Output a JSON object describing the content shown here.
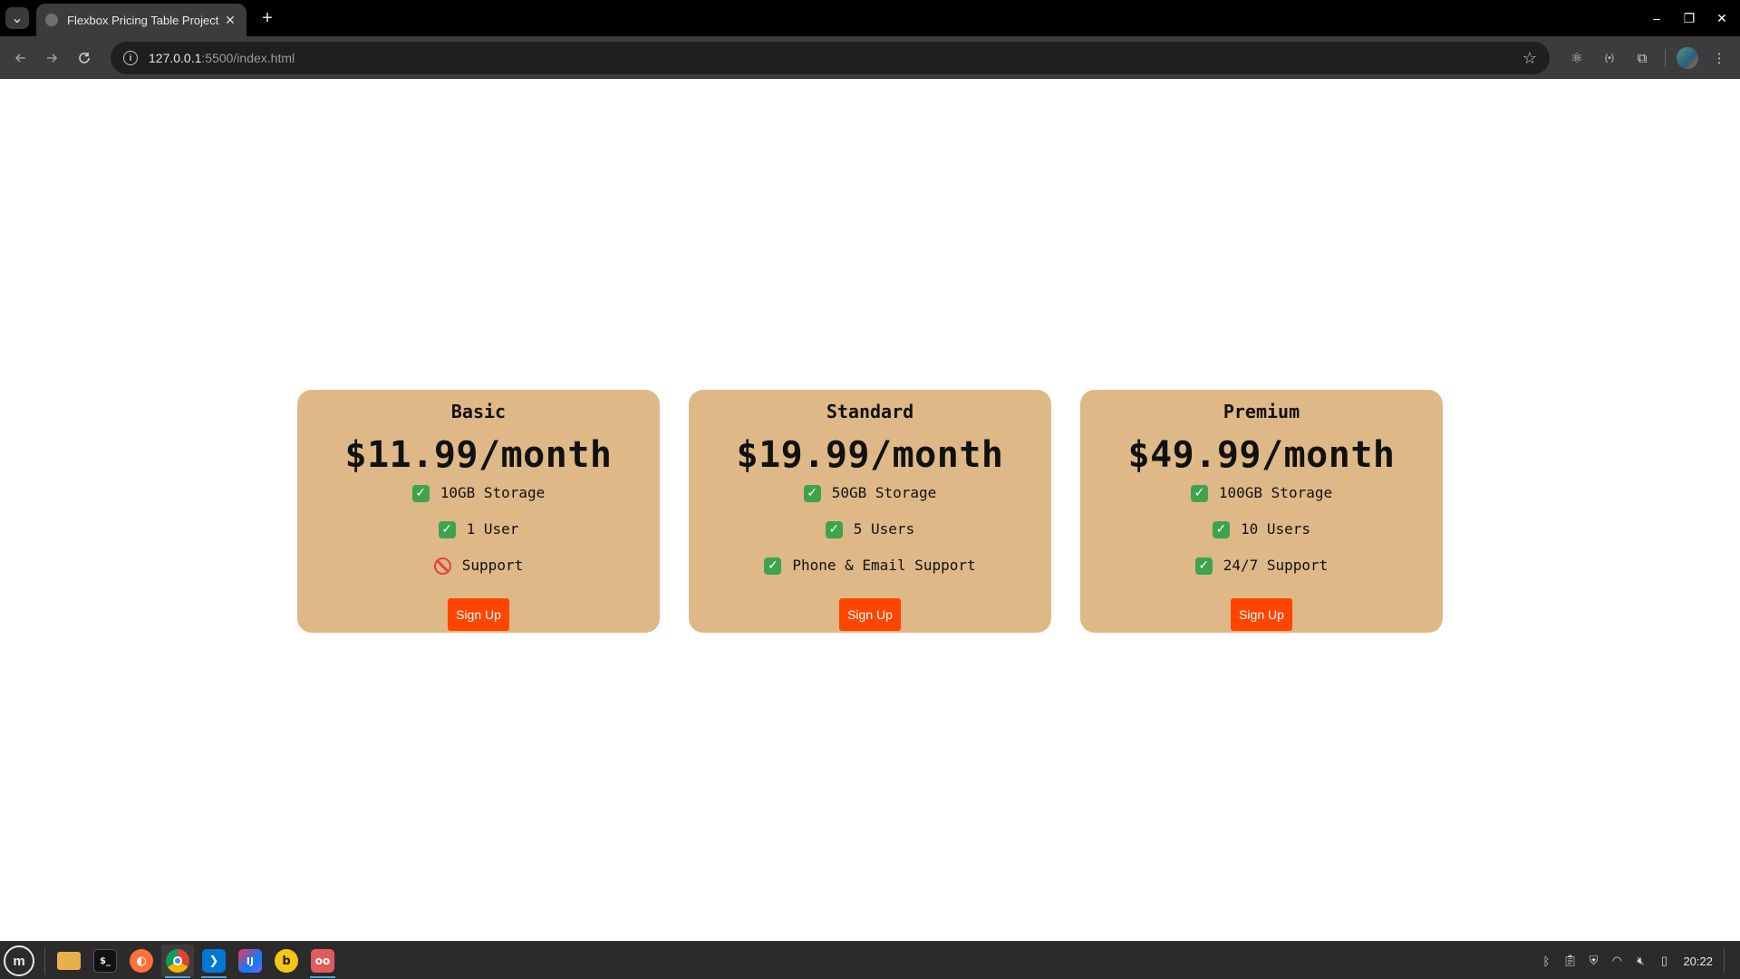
{
  "browser": {
    "tab_title": "Flexbox Pricing Table Project",
    "tab_close": "✕",
    "new_tab": "+",
    "url_host": "127.0.0.1",
    "url_path": ":5500/index.html",
    "window_controls": [
      "‒",
      "❐",
      "✕"
    ]
  },
  "pricing": {
    "plans": [
      {
        "name": "Basic",
        "price": "$11.99/month",
        "features": [
          {
            "text": "10GB Storage",
            "included": true
          },
          {
            "text": "1 User",
            "included": true
          },
          {
            "text": "Support",
            "included": false
          }
        ],
        "button": "Sign Up"
      },
      {
        "name": "Standard",
        "price": "$19.99/month",
        "features": [
          {
            "text": "50GB Storage",
            "included": true
          },
          {
            "text": "5 Users",
            "included": true
          },
          {
            "text": "Phone & Email Support",
            "included": true
          }
        ],
        "button": "Sign Up"
      },
      {
        "name": "Premium",
        "price": "$49.99/month",
        "features": [
          {
            "text": "100GB Storage",
            "included": true
          },
          {
            "text": "10 Users",
            "included": true
          },
          {
            "text": "24/7 Support",
            "included": true
          }
        ],
        "button": "Sign Up"
      }
    ]
  },
  "colors": {
    "card_bg": "#deb887",
    "button_bg": "#ff4500",
    "check_green": "#3fa34d",
    "no_red": "#e0463a"
  },
  "taskbar": {
    "menu_label": "m",
    "apps": [
      "files-icon",
      "terminal-icon",
      "firefox-icon",
      "chrome-icon",
      "vscode-icon",
      "intellij-icon",
      "bitwarden-icon",
      "screen-reader-icon"
    ],
    "clock": "20:22"
  }
}
